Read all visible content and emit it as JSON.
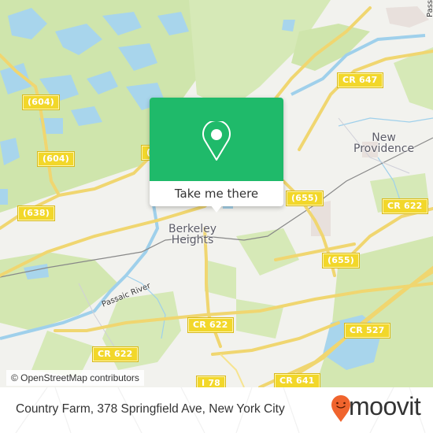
{
  "map": {
    "places": [
      {
        "name": "Berkeley Heights",
        "lines": [
          "Berkeley",
          "Heights"
        ]
      },
      {
        "name": "New Providence",
        "lines": [
          "New",
          "Providence"
        ]
      }
    ],
    "road_shields": [
      {
        "label": "(604)"
      },
      {
        "label": "(604)"
      },
      {
        "label": "(638)"
      },
      {
        "label": "CR 647"
      },
      {
        "label": "(655)"
      },
      {
        "label": "(655)"
      },
      {
        "label": "CR 622"
      },
      {
        "label": "CR 622"
      },
      {
        "label": "CR 622"
      },
      {
        "label": "CR 527"
      },
      {
        "label": "CR 641"
      },
      {
        "label": "I 78"
      },
      {
        "label": "(6"
      }
    ],
    "water_labels": [
      {
        "label": "Passaic River"
      },
      {
        "label": "Passa"
      }
    ],
    "attribution": "© OpenStreetMap contributors"
  },
  "popup": {
    "icon": "map-pin-icon",
    "button_label": "Take me there",
    "accent_color": "#1fba6a"
  },
  "footer": {
    "address": "Country Farm, 378 Springfield Ave, New York City",
    "brand": "moovit",
    "brand_color": "#f0642d"
  }
}
